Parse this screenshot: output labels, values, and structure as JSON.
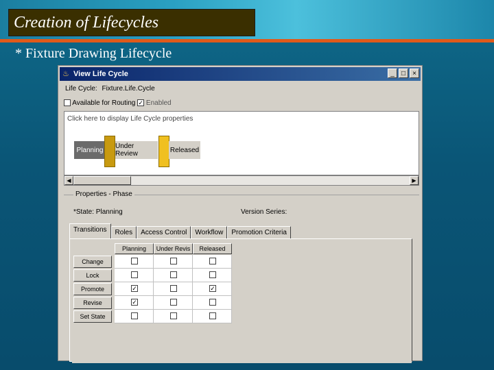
{
  "slide": {
    "title": "Creation of Lifecycles",
    "subtitle": "* Fixture Drawing Lifecycle"
  },
  "window": {
    "title": "View Life Cycle",
    "lifecycle_label": "Life Cycle:",
    "lifecycle_name": "Fixture.Life.Cycle",
    "available_for_routing": "Available for Routing",
    "enabled": "Enabled",
    "hint": "Click here to display Life Cycle properties",
    "phases": [
      "Planning",
      "Under Review",
      "Released"
    ],
    "properties_title": "Properties - Phase",
    "state_label": "*State: Planning",
    "version_label": "Version Series:",
    "tabs": [
      "Transitions",
      "Roles",
      "Access Control",
      "Workflow",
      "Promotion Criteria"
    ],
    "grid": {
      "columns": [
        "Planning",
        "Under Revis",
        "Released"
      ],
      "rows": [
        {
          "label": "Change",
          "checks": [
            false,
            false,
            false
          ]
        },
        {
          "label": "Lock",
          "checks": [
            false,
            false,
            false
          ]
        },
        {
          "label": "Promote",
          "checks": [
            true,
            false,
            true
          ]
        },
        {
          "label": "Revise",
          "checks": [
            true,
            false,
            false
          ]
        },
        {
          "label": "Set State",
          "checks": [
            false,
            false,
            false
          ]
        }
      ]
    }
  },
  "colors": {
    "title_bg": "#3a2f00",
    "accent_line": "#e05a1a",
    "active_phase": "#6b6b6b",
    "gate": "#c89a10"
  }
}
